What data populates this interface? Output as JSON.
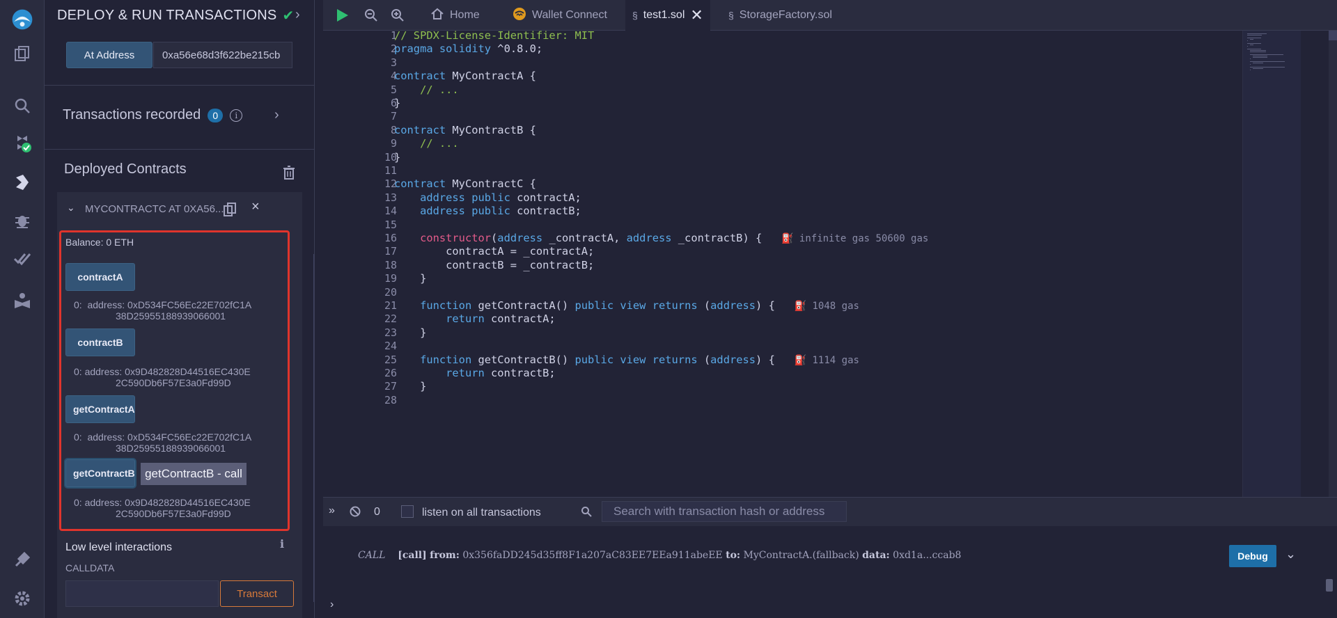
{
  "sidepanel": {
    "title": "DEPLOY & RUN TRANSACTIONS",
    "at_address_button": "At Address",
    "at_address_value": "0xa56e68d3f622be215cb",
    "transactions_recorded_label": "Transactions recorded",
    "transactions_recorded_count": "0",
    "deployed_contracts_label": "Deployed Contracts",
    "contract_instance_title": "MYCONTRACTC AT 0XA56...8A",
    "balance": "Balance: 0 ETH",
    "functions": [
      {
        "label": "contractA",
        "output_prefix": "0:",
        "output_line1": "address: 0xD534FC56Ec22E702fC1A",
        "output_line2": "38D25955188939066001"
      },
      {
        "label": "contractB",
        "output_prefix": "0:",
        "output_line1": "address: 0x9D482828D44516EC430E",
        "output_line2": "2C590Db6F57E3a0Fd99D"
      },
      {
        "label": "getContractA",
        "output_prefix": "0:",
        "output_line1": "address: 0xD534FC56Ec22E702fC1A",
        "output_line2": "38D25955188939066001"
      },
      {
        "label": "getContractB",
        "output_prefix": "0:",
        "output_line1": "address: 0x9D482828D44516EC430E",
        "output_line2": "2C590Db6F57E3a0Fd99D"
      }
    ],
    "tooltip": "getContractB - call",
    "low_level_label": "Low level interactions",
    "calldata_label": "CALLDATA",
    "transact_button": "Transact"
  },
  "tabs": [
    {
      "label": "Home",
      "icon": "home-icon"
    },
    {
      "label": "Wallet Connect",
      "icon": "wallet-connect-icon"
    },
    {
      "label": "test1.sol",
      "icon": "solidity-icon",
      "active": true
    },
    {
      "label": "StorageFactory.sol",
      "icon": "solidity-icon"
    }
  ],
  "editor": {
    "line_numbers": [
      "1",
      "2",
      "3",
      "4",
      "5",
      "6",
      "7",
      "8",
      "9",
      "10",
      "11",
      "12",
      "13",
      "14",
      "15",
      "16",
      "17",
      "18",
      "19",
      "20",
      "21",
      "22",
      "23",
      "24",
      "25",
      "26",
      "27",
      "28"
    ],
    "lines": [
      "// SPDX-License-Identifier: MIT",
      "pragma solidity ^0.8.0;",
      "",
      "contract MyContractA {",
      "    // ...",
      "}",
      "",
      "contract MyContractB {",
      "    // ...",
      "}",
      "",
      "contract MyContractC {",
      "    address public contractA;",
      "    address public contractB;",
      "",
      "    constructor(address _contractA, address _contractB) {",
      "        contractA = _contractA;",
      "        contractB = _contractB;",
      "    }",
      "",
      "    function getContractA() public view returns (address) {",
      "        return contractA;",
      "    }",
      "",
      "    function getContractB() public view returns (address) {",
      "        return contractB;",
      "    }",
      ""
    ],
    "gas_hints": {
      "16": "infinite gas 50600 gas",
      "21": "1048 gas",
      "25": "1114 gas"
    }
  },
  "terminal": {
    "pending_count": "0",
    "listen_label": "listen on all transactions",
    "search_placeholder": "Search with transaction hash or address",
    "log_type": "CALL",
    "log_call": "[call]",
    "log_from_label": "from:",
    "log_from": "0x356faDD245d35ff8F1a207aC83EE7EEa911abeEE",
    "log_to_label": "to:",
    "log_to": "MyContractA.(fallback)",
    "log_data_label": "data:",
    "log_data": "0xd1a...ccab8",
    "debug_button": "Debug",
    "prompt": "›"
  },
  "colors": {
    "background": "#222336",
    "panel": "#2a2c3f",
    "accent_blue": "#335476",
    "highlight_red": "#e0342c",
    "success_green": "#2fbf71",
    "transact_orange": "#d87a3a"
  }
}
